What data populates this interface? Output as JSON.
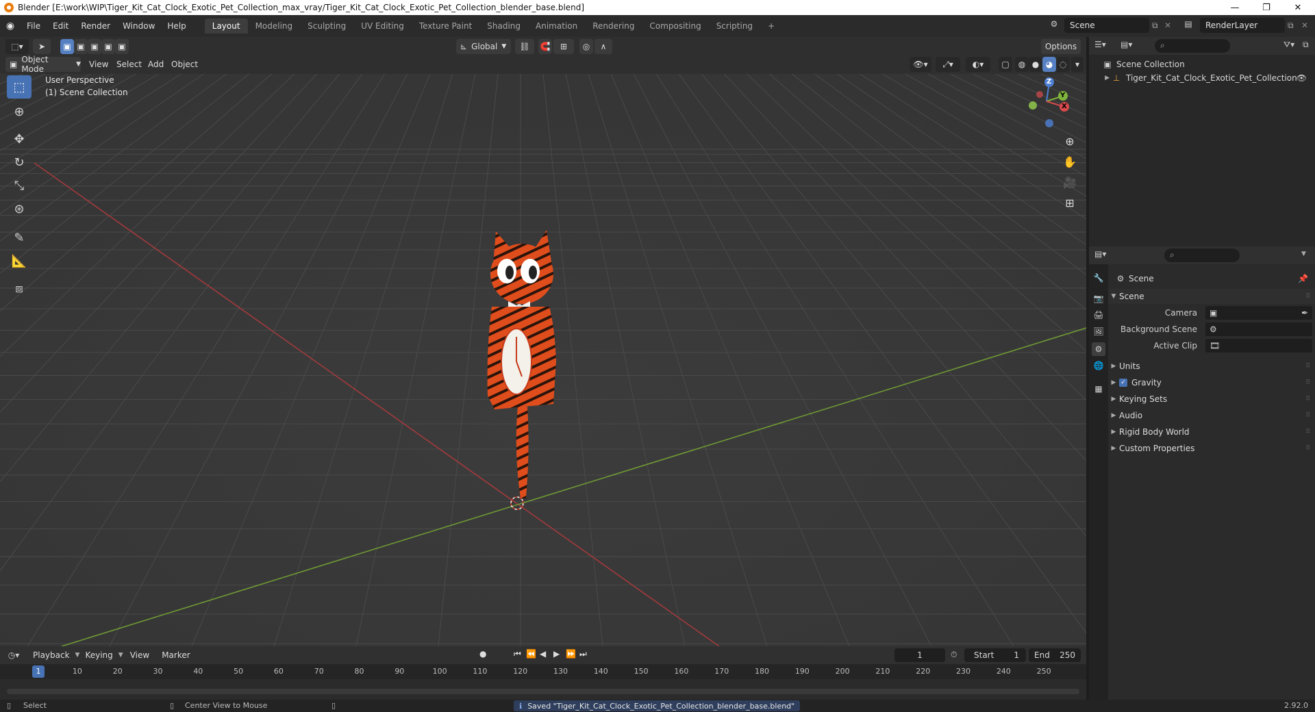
{
  "window": {
    "title": "Blender [E:\\work\\WIP\\Tiger_Kit_Cat_Clock_Exotic_Pet_Collection_max_vray/Tiger_Kit_Cat_Clock_Exotic_Pet_Collection_blender_base.blend]",
    "minimize": "—",
    "restore": "❐",
    "close": "✕"
  },
  "menubar": {
    "items": [
      "File",
      "Edit",
      "Render",
      "Window",
      "Help"
    ],
    "workspaces": [
      "Layout",
      "Modeling",
      "Sculpting",
      "UV Editing",
      "Texture Paint",
      "Shading",
      "Animation",
      "Rendering",
      "Compositing",
      "Scripting"
    ],
    "active_workspace": "Layout",
    "add_workspace": "+",
    "scene_name": "Scene",
    "view_layer": "RenderLayer"
  },
  "viewport_header": {
    "mode": "Object Mode",
    "menus": [
      "View",
      "Select",
      "Add",
      "Object"
    ],
    "transform_orientation": "Global",
    "options": "Options"
  },
  "viewport": {
    "overlay_line1": "User Perspective",
    "overlay_line2": "(1) Scene Collection",
    "gizmo": {
      "z": "Z",
      "y": "Y",
      "x": "X"
    }
  },
  "outliner": {
    "root": "Scene Collection",
    "items": [
      "Tiger_Kit_Cat_Clock_Exotic_Pet_Collection"
    ]
  },
  "properties": {
    "context": "Scene",
    "section": "Scene",
    "fields": [
      {
        "label": "Camera",
        "value": ""
      },
      {
        "label": "Background Scene",
        "value": ""
      },
      {
        "label": "Active Clip",
        "value": ""
      }
    ],
    "panels": [
      "Units",
      "Gravity",
      "Keying Sets",
      "Audio",
      "Rigid Body World",
      "Custom Properties"
    ],
    "gravity_checked": true
  },
  "timeline": {
    "menus": [
      "Playback",
      "Keying",
      "View",
      "Marker"
    ],
    "current_frame": "1",
    "start_label": "Start",
    "start_value": "1",
    "end_label": "End",
    "end_value": "250",
    "ruler_ticks": [
      "1",
      "10",
      "20",
      "30",
      "40",
      "50",
      "60",
      "70",
      "80",
      "90",
      "100",
      "110",
      "120",
      "130",
      "140",
      "150",
      "160",
      "170",
      "180",
      "190",
      "200",
      "210",
      "220",
      "230",
      "240",
      "250"
    ]
  },
  "statusbar": {
    "left": "Select",
    "middle": "Center View to Mouse",
    "message": "Saved \"Tiger_Kit_Cat_Clock_Exotic_Pet_Collection_blender_base.blend\"",
    "version": "2.92.0"
  },
  "colors": {
    "accent": "#4772b3",
    "axis_x": "#c0393b",
    "axis_y": "#7aa83a",
    "tiger_orange": "#e4501e"
  }
}
